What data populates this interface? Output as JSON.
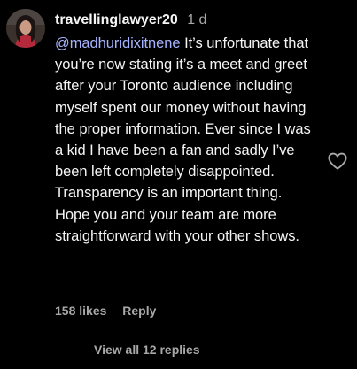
{
  "comment": {
    "username": "travellinglawyer20",
    "time": "1 d",
    "mention": "@madhuridixitnene",
    "text": " It’s unfortunate that you’re now stating it’s a meet and greet after your Toronto audience including myself spent our money without having the proper information. Ever since I was a kid I have been a fan and sadly I’ve been left completely disappointed. Transparency is an important thing. Hope you and your team are more straightforward with your other shows.",
    "likes": "158 likes",
    "reply_label": "Reply",
    "like_icon": "heart-outline-icon",
    "view_replies": "View all 12 replies"
  },
  "colors": {
    "background": "#000000",
    "primary_text": "#f5f5f5",
    "secondary_text": "#a8a8a8",
    "mention": "#a6b4ff",
    "divider": "#737373"
  }
}
